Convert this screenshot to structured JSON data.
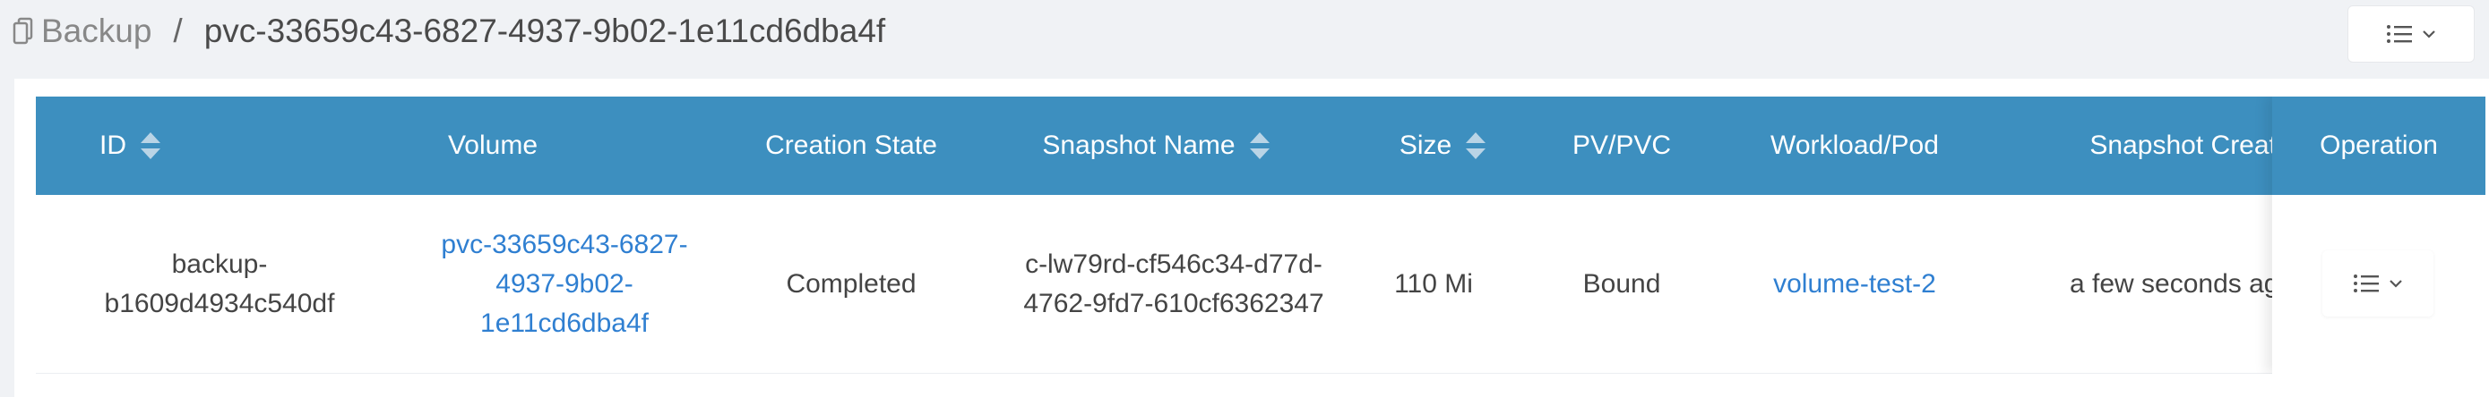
{
  "breadcrumb": {
    "root": "Backup",
    "separator": "/",
    "current": "pvc-33659c43-6827-4937-9b02-1e11cd6dba4f"
  },
  "header": {
    "menu_icon": "list-icon",
    "menu_caret": "chevron-down-icon"
  },
  "table": {
    "columns": {
      "id": "ID",
      "volume": "Volume",
      "creation_state": "Creation State",
      "snapshot_name": "Snapshot Name",
      "size": "Size",
      "pv_pvc": "PV/PVC",
      "workload_pod": "Workload/Pod",
      "snapshot_created": "Snapshot Create",
      "operation": "Operation"
    },
    "rows": [
      {
        "id_line1": "backup-",
        "id_line2": "b1609d4934c540df",
        "volume_line1": "pvc-33659c43-6827-",
        "volume_line2": "4937-9b02-",
        "volume_line3": "1e11cd6dba4f",
        "creation_state": "Completed",
        "snapshot_line1": "c-lw79rd-cf546c34-d77d-",
        "snapshot_line2": "4762-9fd7-610cf6362347",
        "size": "110 Mi",
        "pv_pvc": "Bound",
        "workload_pod": "volume-test-2",
        "snapshot_created": "a few seconds ago"
      }
    ]
  },
  "colors": {
    "header_bg": "#3d8fbf",
    "link": "#2f7fd1",
    "page_bg": "#f0f2f5"
  }
}
